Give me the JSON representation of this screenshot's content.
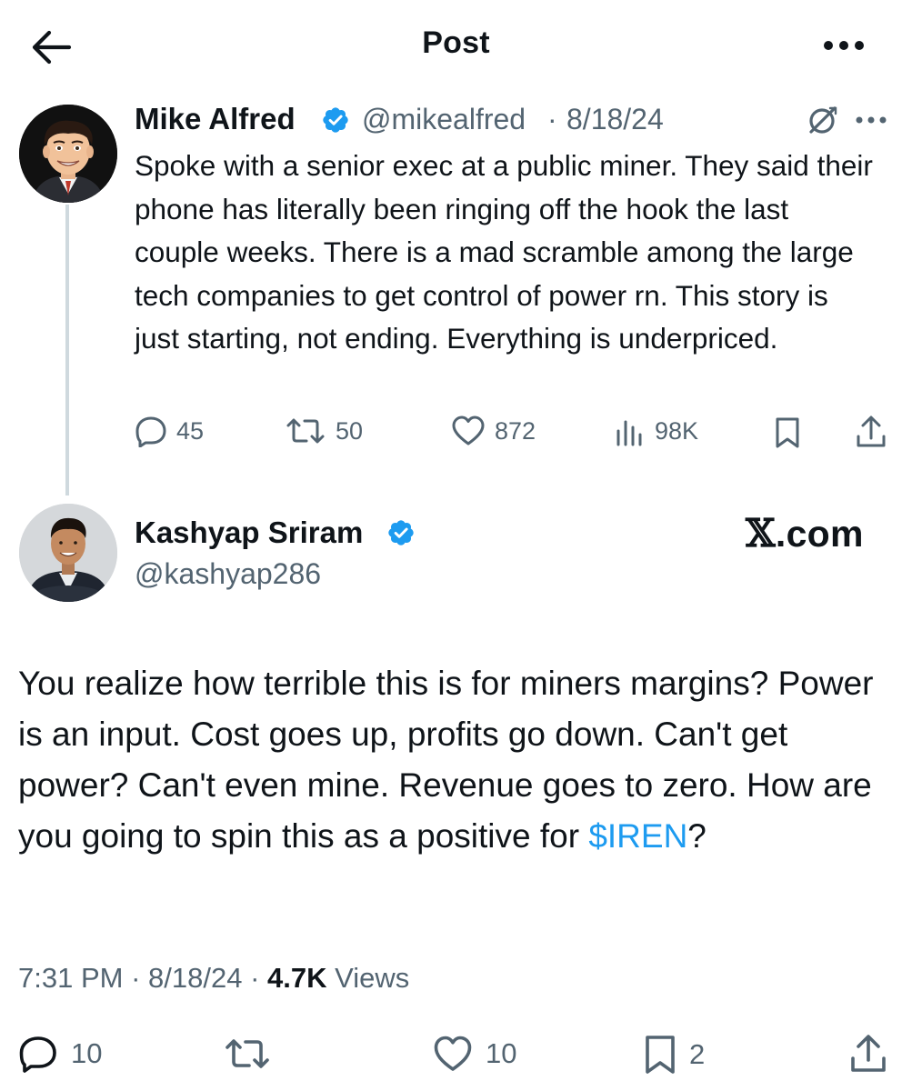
{
  "header": {
    "title": "Post",
    "back_icon": "arrow-left-icon",
    "more_icon": "more-horizontal-icon"
  },
  "quoted_post": {
    "author_name": "Mike Alfred",
    "handle": "@mikealfred",
    "separator": "·",
    "date": "8/18/24",
    "verified": true,
    "text": "Spoke with a senior exec at a public miner. They said their phone has literally been ringing off the hook the last couple weeks. There is a mad scramble among the large tech companies to get control of power rn. This story is just starting, not ending. Everything is underpriced.",
    "stats": {
      "replies": "45",
      "reposts": "50",
      "likes": "872",
      "views": "98K"
    }
  },
  "reply_post": {
    "author_name": "Kashyap Sriram",
    "handle": "@kashyap286",
    "verified": true,
    "watermark": ".com",
    "watermark_glyph": "𝕏",
    "text_before_cashtag": "You realize how terrible this is for miners margins? Power is an input. Cost goes up, profits go down. Can't get power? Can't even mine. Revenue goes to zero. How are you going to spin this as a positive for ",
    "cashtag": "$IREN",
    "text_after_cashtag": "?",
    "time": "7:31 PM",
    "date": "8/18/24",
    "separator": "·",
    "views_count": "4.7K",
    "views_label": "Views",
    "stats": {
      "replies": "10",
      "likes": "10",
      "bookmarks": "2"
    }
  },
  "colors": {
    "text": "#0f1419",
    "secondary": "#536471",
    "link": "#1d9bf0",
    "verified": "#1d9bf0",
    "thread_line": "#cfd9de"
  }
}
